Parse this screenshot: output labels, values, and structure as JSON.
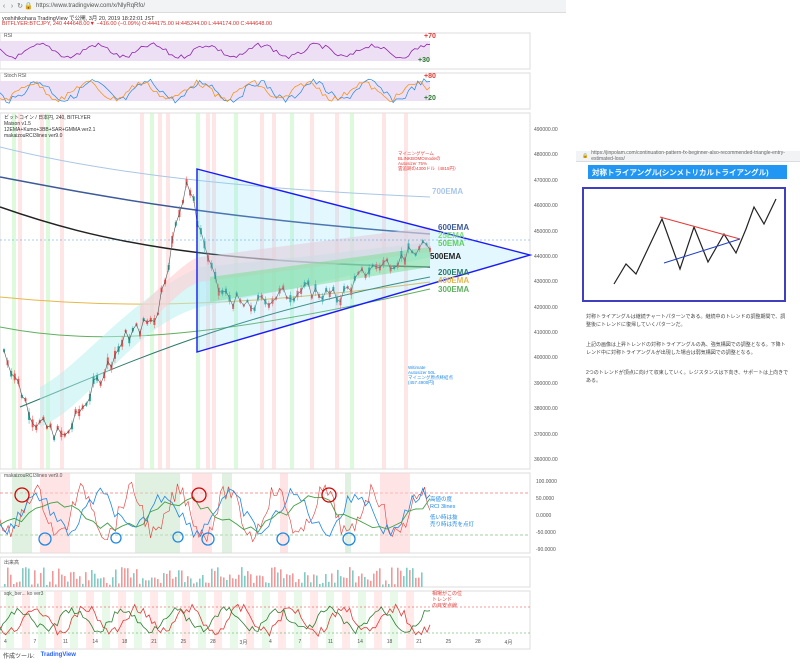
{
  "browser": {
    "url": "https://www.tradingview.com/x/NlyRqRfo/"
  },
  "header": {
    "line1": "yoshihikohara TradingView で公開, 3月 20, 2019 18:22:01 JST",
    "line2": "BITFLYER:BTCJPY, 240 444648.00▼ −416.00 (−0.09%) O:444175.00 H:445244.00 L:444174.00 C:444648.00",
    "line2_color": "#d32f2f"
  },
  "rsi": {
    "label": "RSI",
    "upper": "+70",
    "lower": "+30",
    "upper_color": "#e53935",
    "lower_color": "#2e7d32"
  },
  "stoch": {
    "label": "Stoch RSI",
    "upper": "+80",
    "lower": "+20",
    "upper_color": "#e53935",
    "lower_color": "#2e7d32"
  },
  "main": {
    "legend": [
      "ビットコイン / 日本円, 240, BITFLYER",
      "Maison v1.5",
      "12EMA+Kumo+3BB+SAR+GMMA ver2.1",
      "makaizouRCI3lines ver9.0"
    ],
    "price_ticks": [
      "490000.00",
      "480000.00",
      "470000.00",
      "460000.00",
      "450000.00",
      "440000.00",
      "430000.00",
      "420000.00",
      "410000.00",
      "400000.00",
      "390000.00",
      "380000.00",
      "370000.00",
      "360000.00"
    ],
    "ema_labels": [
      {
        "text": "700EMA",
        "color": "#a9c6e8"
      },
      {
        "text": "600EMA",
        "color": "#3d5a99"
      },
      {
        "text": "25EMA",
        "color": "#7ee07e"
      },
      {
        "text": "50EMA",
        "color": "#5fd05f"
      },
      {
        "text": "500EMA",
        "color": "#222222"
      },
      {
        "text": "200EMA",
        "color": "#2a7a6a"
      },
      {
        "text": "400EMA",
        "color": "#e6b84a"
      },
      {
        "text": "300EMA",
        "color": "#5fb05f"
      }
    ],
    "annotation_red": [
      "マイニングゲーム",
      "BLINKBOMOmodeの",
      "Autosizer 75%",
      "雲追跡の4300ドル（4815円）"
    ],
    "annotation_blue": [
      "Witimate",
      "Autosizer 50L",
      "マイニング原点終結点",
      "(457.4900円)"
    ]
  },
  "rci": {
    "label": "makaizouRCI3lines ver9.0",
    "notes": [
      "高値の度",
      "RCI 3lines",
      "低い時は抜",
      "売り時は売を点灯"
    ],
    "ticks": [
      "100.0000",
      "50.0000",
      "0.0000",
      "-50.0000",
      "-90.0000"
    ]
  },
  "volume": {
    "label": "出来高"
  },
  "bottom": {
    "label": "sqk_ber... ko ver3",
    "notes": [
      "相場がこの位",
      "トレンド",
      "の目安点線"
    ]
  },
  "x_ticks": [
    "4",
    "7",
    "11",
    "14",
    "18",
    "21",
    "25",
    "28",
    "3月",
    "4",
    "7",
    "11",
    "14",
    "18",
    "21",
    "25",
    "28",
    "4月"
  ],
  "footer": {
    "prefix": "作成ツール:",
    "brand": "TradingView"
  },
  "right": {
    "url": "https://jinpolam.com/continuation-pattern-fx-beginner-also-recommended-triangle-entry-estimated-loss/",
    "title": "対称トライアングル(シンメトリカルトライアングル)",
    "paragraphs": [
      "対称トライアングルは継続チャートパターンである。継続中のトレンドの調整期間で、調整後にトレンドに復帰していくパターンだ。",
      "上記の画像は上昇トレンドの対称トライアングルの為、強気構図での調整となる。下降トレンド中に対称トライアングルが出現した場合は弱気構図での調整となる。",
      "2つのトレンドが頂点に向けて収束していく。レジスタンスは下向き、サポートは上向きである。"
    ]
  },
  "chart_data": [
    {
      "type": "line",
      "title": "",
      "series": [
        {
          "name": "ビットコイン / 日本円",
          "values": [
            405000,
            378000,
            372000,
            392000,
            410000,
            418000,
            470000,
            428000,
            421000,
            426000,
            428000,
            425000,
            436000,
            440000,
            444648
          ]
        }
      ],
      "ylim": [
        360000,
        495000
      ]
    }
  ]
}
